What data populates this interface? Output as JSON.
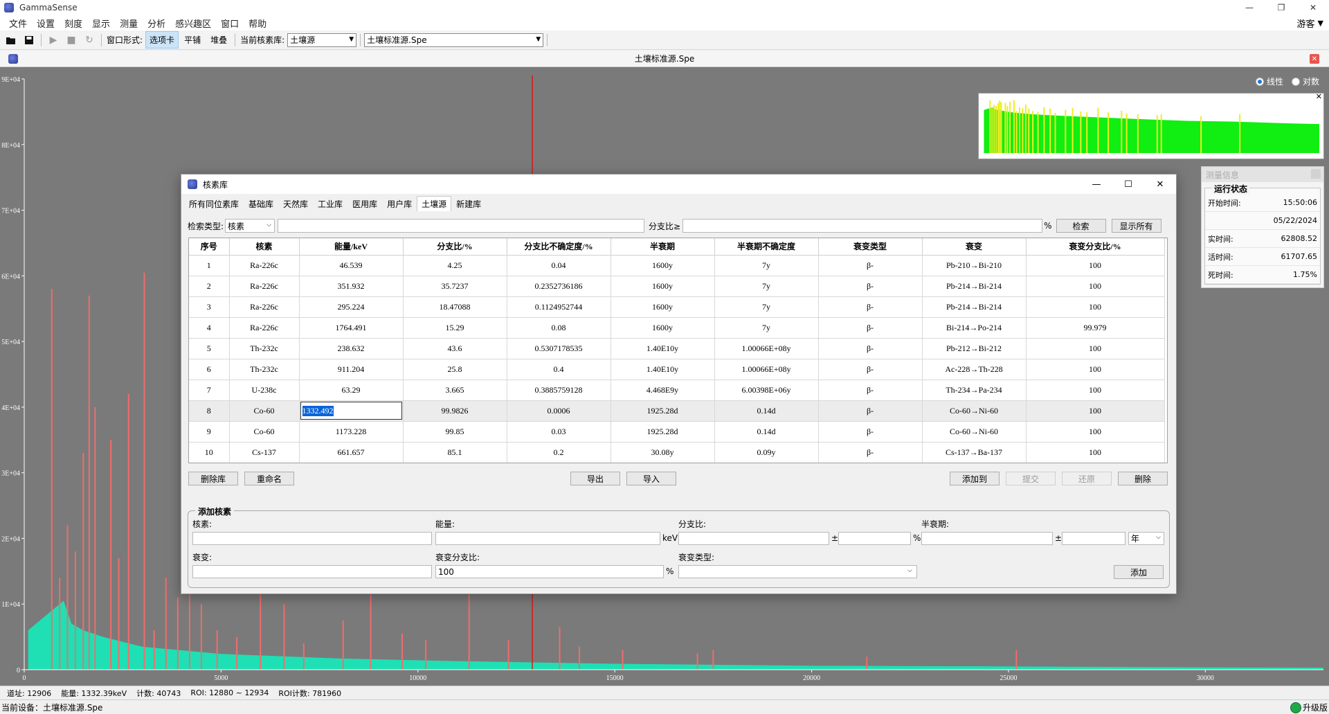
{
  "app": {
    "title": "GammaSense",
    "user": "游客",
    "window_controls": [
      "—",
      "❐",
      "✕"
    ]
  },
  "menu": [
    "文件",
    "设置",
    "刻度",
    "显示",
    "测量",
    "分析",
    "感兴趣区",
    "窗口",
    "帮助"
  ],
  "toolbar": {
    "window_mode_label": "窗口形式:",
    "mode_tabs": "选项卡",
    "mode_tile": "平铺",
    "mode_stack": "堆叠",
    "current_lib_label": "当前核素库:",
    "current_lib_value": "土壤源",
    "current_file_value": "土壤标准源.Spe"
  },
  "document": {
    "title": "土壤标准源.Spe",
    "scale_linear": "线性",
    "scale_log": "对数"
  },
  "chart_data": {
    "type": "bar",
    "x_ticks": [
      "0",
      "5000",
      "10000",
      "15000",
      "20000",
      "25000",
      "30000"
    ],
    "y_ticks": [
      "0",
      "1E+04",
      "2E+04",
      "3E+04",
      "4E+04",
      "5E+04",
      "6E+04",
      "7E+04",
      "8E+04",
      "9E+04"
    ],
    "xlim": [
      0,
      33000
    ],
    "ylim": [
      0,
      90000
    ],
    "cursor_channel": 12906,
    "colors": {
      "background": "#7a7a7a",
      "continuum": "#1ee0b4",
      "peaks": "#f26c6c",
      "cursor": "#d61a1a",
      "overview_fill": "#11ee11",
      "overview_peaks": "#eeee22"
    },
    "peaks": [
      {
        "x": 700,
        "y": 58000
      },
      {
        "x": 900,
        "y": 14000
      },
      {
        "x": 1100,
        "y": 22000
      },
      {
        "x": 1300,
        "y": 18000
      },
      {
        "x": 1500,
        "y": 33000
      },
      {
        "x": 1650,
        "y": 57000
      },
      {
        "x": 1800,
        "y": 40000
      },
      {
        "x": 2200,
        "y": 35000
      },
      {
        "x": 2400,
        "y": 17000
      },
      {
        "x": 2650,
        "y": 42000
      },
      {
        "x": 3050,
        "y": 60500
      },
      {
        "x": 3300,
        "y": 6000
      },
      {
        "x": 3600,
        "y": 14000
      },
      {
        "x": 3900,
        "y": 11000
      },
      {
        "x": 4200,
        "y": 24000
      },
      {
        "x": 4500,
        "y": 10000
      },
      {
        "x": 4900,
        "y": 6000
      },
      {
        "x": 5400,
        "y": 5000
      },
      {
        "x": 6000,
        "y": 13500
      },
      {
        "x": 6600,
        "y": 10000
      },
      {
        "x": 7100,
        "y": 4000
      },
      {
        "x": 8100,
        "y": 7500
      },
      {
        "x": 8800,
        "y": 12000
      },
      {
        "x": 9600,
        "y": 5500
      },
      {
        "x": 10200,
        "y": 4500
      },
      {
        "x": 11300,
        "y": 12000
      },
      {
        "x": 12300,
        "y": 4500
      },
      {
        "x": 13600,
        "y": 6500
      },
      {
        "x": 14100,
        "y": 3500
      },
      {
        "x": 15200,
        "y": 3000
      },
      {
        "x": 17100,
        "y": 2500
      },
      {
        "x": 17500,
        "y": 3000
      },
      {
        "x": 21400,
        "y": 2000
      },
      {
        "x": 25200,
        "y": 3000
      }
    ],
    "continuum": [
      {
        "x": 100,
        "y": 6000
      },
      {
        "x": 400,
        "y": 7500
      },
      {
        "x": 700,
        "y": 9000
      },
      {
        "x": 1000,
        "y": 10500
      },
      {
        "x": 1200,
        "y": 7000
      },
      {
        "x": 1500,
        "y": 6000
      },
      {
        "x": 2000,
        "y": 5000
      },
      {
        "x": 3000,
        "y": 3500
      },
      {
        "x": 5000,
        "y": 2400
      },
      {
        "x": 8000,
        "y": 1700
      },
      {
        "x": 11000,
        "y": 1300
      },
      {
        "x": 15000,
        "y": 900
      },
      {
        "x": 20000,
        "y": 600
      },
      {
        "x": 25000,
        "y": 500
      },
      {
        "x": 30000,
        "y": 350
      },
      {
        "x": 33000,
        "y": 300
      }
    ]
  },
  "measure_panel": {
    "title": "测量信息",
    "group_label": "运行状态",
    "rows": [
      {
        "label": "开始时间:",
        "value": "15:50:06"
      },
      {
        "label": "",
        "value": "05/22/2024"
      },
      {
        "label": "实时间:",
        "value": "62808.52"
      },
      {
        "label": "活时间:",
        "value": "61707.65"
      },
      {
        "label": "死时间:",
        "value": "1.75%"
      }
    ]
  },
  "status": {
    "channel": "道址: 12906",
    "energy": "能量: 1332.39keV",
    "count": "计数: 40743",
    "roi": "ROI: 12880 ~ 12934",
    "roi_count": "ROI计数: 781960",
    "device": "当前设备：土壤标准源.Spe",
    "upgrade": "升级版"
  },
  "dialog": {
    "title": "核素库",
    "tabs": [
      "所有同位素库",
      "基础库",
      "天然库",
      "工业库",
      "医用库",
      "用户库",
      "土壤源",
      "新建库"
    ],
    "active_tab": 6,
    "search_type_label": "检索类型:",
    "search_type_value": "核素",
    "branch_label": "分支比≥",
    "percent": "%",
    "search_button": "检索",
    "show_all_button": "显示所有",
    "columns": [
      "序号",
      "核素",
      "能量/keV",
      "分支比/%",
      "分支比不确定度/%",
      "半衰期",
      "半衰期不确定度",
      "衰变类型",
      "衰变",
      "衰变分支比/%"
    ],
    "rows": [
      [
        "1",
        "Ra-226c",
        "46.539",
        "4.25",
        "0.04",
        "1600y",
        "7y",
        "β-",
        "Pb-210→Bi-210",
        "100"
      ],
      [
        "2",
        "Ra-226c",
        "351.932",
        "35.7237",
        "0.2352736186",
        "1600y",
        "7y",
        "β-",
        "Pb-214→Bi-214",
        "100"
      ],
      [
        "3",
        "Ra-226c",
        "295.224",
        "18.47088",
        "0.1124952744",
        "1600y",
        "7y",
        "β-",
        "Pb-214→Bi-214",
        "100"
      ],
      [
        "4",
        "Ra-226c",
        "1764.491",
        "15.29",
        "0.08",
        "1600y",
        "7y",
        "β-",
        "Bi-214→Po-214",
        "99.979"
      ],
      [
        "5",
        "Th-232c",
        "238.632",
        "43.6",
        "0.5307178535",
        "1.40E10y",
        "1.00066E+08y",
        "β-",
        "Pb-212→Bi-212",
        "100"
      ],
      [
        "6",
        "Th-232c",
        "911.204",
        "25.8",
        "0.4",
        "1.40E10y",
        "1.00066E+08y",
        "β-",
        "Ac-228→Th-228",
        "100"
      ],
      [
        "7",
        "U-238c",
        "63.29",
        "3.665",
        "0.3885759128",
        "4.468E9y",
        "6.00398E+06y",
        "β-",
        "Th-234→Pa-234",
        "100"
      ],
      [
        "8",
        "Co-60",
        "1332.492",
        "99.9826",
        "0.0006",
        "1925.28d",
        "0.14d",
        "β-",
        "Co-60→Ni-60",
        "100"
      ],
      [
        "9",
        "Co-60",
        "1173.228",
        "99.85",
        "0.03",
        "1925.28d",
        "0.14d",
        "β-",
        "Co-60→Ni-60",
        "100"
      ],
      [
        "10",
        "Cs-137",
        "661.657",
        "85.1",
        "0.2",
        "30.08y",
        "0.09y",
        "β-",
        "Cs-137→Ba-137",
        "100"
      ]
    ],
    "selected_row": 7,
    "buttons": {
      "delete_lib": "删除库",
      "rename": "重命名",
      "export": "导出",
      "import": "导入",
      "add_to": "添加到",
      "submit": "提交",
      "restore": "还原",
      "delete": "删除"
    },
    "add_group": {
      "label": "添加核素",
      "nuclide_label": "核素:",
      "energy_label": "能量:",
      "energy_unit": "keV",
      "branch_label": "分支比:",
      "pm": "±",
      "percent": "%",
      "half_life_label": "半衰期:",
      "half_life_unit": "年",
      "decay_label": "衰变:",
      "decay_branch_label": "衰变分支比:",
      "decay_branch_value": "100",
      "decay_type_label": "衰变类型:",
      "add_button": "添加"
    }
  }
}
